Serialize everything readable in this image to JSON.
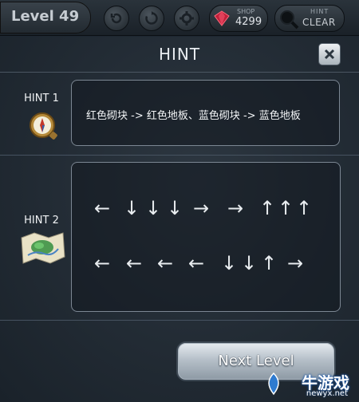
{
  "topbar": {
    "level_label": "Level 49",
    "shop_label": "SHOP",
    "shop_value": "4299",
    "hint_label": "HINT",
    "hint_value": "CLEAR"
  },
  "dialog": {
    "title": "HINT",
    "hint1": {
      "label": "HINT 1",
      "text": "红色砌块 -> 红色地板、蓝色砌块 -> 蓝色地板",
      "icon": "compass-icon"
    },
    "hint2": {
      "label": "HINT 2",
      "icon": "map-icon",
      "row1": [
        "←",
        "↓",
        "↓",
        "↓",
        "→",
        "→",
        "↑",
        "↑",
        "↑"
      ],
      "row2": [
        "←",
        "←",
        "←",
        "←",
        "↓",
        "↓",
        "↑",
        "→"
      ]
    },
    "next_button": "Next Level"
  },
  "watermark": {
    "main": "牛游戏",
    "sub": "newyx.net"
  }
}
